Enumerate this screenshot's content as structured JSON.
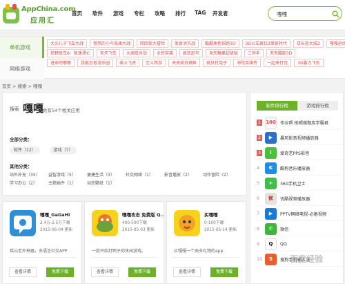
{
  "header": {
    "logo_en": "AppChina.com",
    "logo_cn": "应用汇",
    "nav": [
      "首页",
      "软件",
      "游戏",
      "专栏",
      "攻略",
      "排行",
      "TAG",
      "开发者"
    ],
    "search_value": "嘎嘎"
  },
  "categories": {
    "tab_active": "单机游戏",
    "tab_inactive": "网络游戏",
    "rows": [
      [
        "大头儿子飞车大战",
        "愤怒的小鸟海滩大战",
        "回回侠大冒险",
        "美食消灭战",
        "酷酷角色快跑3D",
        "3D火车疯狂2单驱时代",
        "双长鲨大城2",
        "嘎嘎运动1"
      ],
      [
        "狂野联车8：极速漂亡",
        "天天飞车",
        "大阐砥对战",
        "全民突袭",
        "疯狂赶鸟",
        "海天糖果超级版",
        "二师手",
        "天天酷跑3D"
      ],
      [
        "进击吧嘟嘟",
        "我能忍者游乐园",
        "乘火飞虎",
        "至斗西游",
        "天天疯狂捕鱼",
        "疯狂打兔子",
        "海陀英雄传",
        "一起来打怪",
        "3D暴力飞车"
      ]
    ]
  },
  "breadcrumb": "首页 > 搜索 > 嘎嘎",
  "search_result": {
    "label": "搜索",
    "term": "嘎嘎",
    "count_text": "共有54个相关应用"
  },
  "filters": {
    "all_title": "全部分类：",
    "all": [
      "软件（12）",
      "游戏（7）"
    ],
    "other_title": "其他分类：",
    "other": [
      [
        "站外补充（35）",
        "益智游戏（5）",
        "便捷生活（3）",
        "社交网络（1）",
        "影音播放（2）",
        "动作冒险（2）"
      ],
      [
        "学习办公（2）",
        "主题插件（1）",
        "动态壁纸（1）"
      ]
    ]
  },
  "cards": [
    {
      "name": "嘎嘎_GaGaHi",
      "size": "2.4万-2.5万下载",
      "date": "2015-06-04 更新",
      "desc": "摇山老外神器，多语言社交APP",
      "icon_color": "#2e8fd7",
      "detail": "查看详情",
      "download": "免费下载"
    },
    {
      "name": "嘎嘎攻击 免费版 Q...",
      "size": "400-500下载",
      "date": "2015-05-03 更新",
      "desc": "一款开始打鸭子的休闲游戏。",
      "icon_color": "#f4c400",
      "detail": "查看详情",
      "download": "免费下载"
    },
    {
      "name": "买嘎嘎",
      "size": "0-100下载",
      "date": "2015-05-14 更新",
      "desc": "买嘎嘎一个由多礼物的app",
      "icon_color": "#f7d21a",
      "detail": "查看详情",
      "download": "免费下载"
    }
  ],
  "sidebar": {
    "tab_on": "软件排行榜",
    "tab_off": "游戏排行榜",
    "items": [
      {
        "rank": "1",
        "name": "作业帮 拍照搜题库学霸君",
        "color": "#ffffff",
        "glyph": "100",
        "fg": "#e74c3c"
      },
      {
        "rank": "2",
        "name": "暴风影音视频播放器",
        "color": "#2d6fc7",
        "glyph": "▶",
        "fg": "#ffffff"
      },
      {
        "rank": "3",
        "name": "爱奇艺PPS影音",
        "color": "#4cbf3f",
        "glyph": "i",
        "fg": "#ffffff"
      },
      {
        "rank": "4",
        "name": "酷狗音乐播放器",
        "color": "#1f8ce6",
        "glyph": "K",
        "fg": "#ffffff"
      },
      {
        "rank": "5",
        "name": "360手机卫士",
        "color": "#3fbf4a",
        "glyph": "+",
        "fg": "#ffffff"
      },
      {
        "rank": "6",
        "name": "优酷视频播放器",
        "color": "#e3e3e3",
        "glyph": "优",
        "fg": "#d00"
      },
      {
        "rank": "7",
        "name": "PPTV网络电视-必备视频",
        "color": "#1a7bd6",
        "glyph": "▶",
        "fg": "#ffffff"
      },
      {
        "rank": "8",
        "name": "微信",
        "color": "#3fb63a",
        "glyph": "✆",
        "fg": "#ffffff"
      },
      {
        "rank": "9",
        "name": "QQ",
        "color": "#ffffff",
        "glyph": "Q",
        "fg": "#111"
      },
      {
        "rank": "10",
        "name": "搜狗手机输入法",
        "color": "#ec5d2e",
        "glyph": "S",
        "fg": "#ffffff"
      }
    ]
  },
  "watermark": "百度经验",
  "colors": {
    "accent": "#6bb22a",
    "tag_red": "#d9534f"
  }
}
